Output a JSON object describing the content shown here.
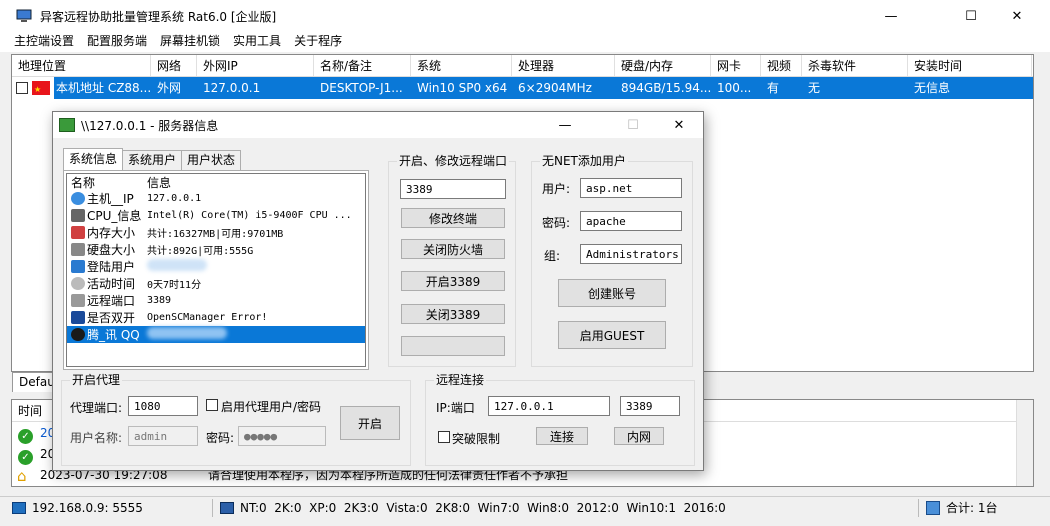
{
  "window": {
    "title": "异客远程协助批量管理系统 Rat6.0 [企业版]",
    "min": "—",
    "max": "☐",
    "close": "✕"
  },
  "menu": [
    "主控端设置",
    "配置服务端",
    "屏幕挂机锁",
    "实用工具",
    "关于程序"
  ],
  "grid": {
    "headers": [
      "地理位置",
      "网络",
      "外网IP",
      "名称/备注",
      "系统",
      "处理器",
      "硬盘/内存",
      "网卡",
      "视频",
      "杀毒软件",
      "安装时间"
    ],
    "row": [
      "本机地址 CZ88...",
      "外网",
      "127.0.0.1",
      "DESKTOP-J1...",
      "Win10 SP0 x64",
      "6×2904MHz",
      "894GB/15.94...",
      "100...",
      "有",
      "无",
      "无信息"
    ]
  },
  "bottom_tab": "Default",
  "log": {
    "header": "时间",
    "rows": [
      {
        "time": "20",
        "msg": ""
      },
      {
        "time": "20",
        "msg": ""
      },
      {
        "time": "2023-07-30 19:27:08",
        "msg": "请合理使用本程序，因为本程序所造成的任何法律责任作者不予承担"
      }
    ]
  },
  "status": {
    "ip": "192.168.0.9: 5555",
    "os": "NT:0  2K:0  XP:0  2K3:0  Vista:0  2K8:0  Win7:0  Win8:0  2012:0  Win10:1  2016:0",
    "total": "合计: 1台"
  },
  "dialog": {
    "title": "\\\\127.0.0.1 - 服务器信息",
    "tabs": [
      "系统信息",
      "系统用户",
      "用户状态"
    ],
    "info_head": [
      "名称",
      "信息"
    ],
    "info_rows": [
      {
        "k": "主机__IP",
        "v": "127.0.0.1",
        "icon": "globe-icon",
        "color": "#3a8ee0"
      },
      {
        "k": "CPU_信息",
        "v": "Intel(R) Core(TM) i5-9400F CPU ...",
        "icon": "cpu-icon",
        "color": "#666666"
      },
      {
        "k": "内存大小",
        "v": "共计:16327MB|可用:9701MB",
        "icon": "memory-icon",
        "color": "#d04040"
      },
      {
        "k": "硬盘大小",
        "v": "共计:892G|可用:555G",
        "icon": "disk-icon",
        "color": "#888888"
      },
      {
        "k": "登陆用户",
        "v": "",
        "icon": "user-icon",
        "color": "#2a7ad0"
      },
      {
        "k": "活动时间",
        "v": "0天7时11分",
        "icon": "clock-icon",
        "color": "#bbbbbb"
      },
      {
        "k": "远程端口",
        "v": "3389",
        "icon": "server-icon",
        "color": "#999999"
      },
      {
        "k": "是否双开",
        "v": "OpenSCManager Error!",
        "icon": "monitor-icon",
        "color": "#1a4a9a"
      },
      {
        "k": "腾_讯 QQ",
        "v": "",
        "icon": "qq-icon",
        "color": "#1a1a1a"
      }
    ],
    "port_group": {
      "label": "开启、修改远程端口",
      "value": "3389",
      "buttons": [
        "修改终端",
        "关闭防火墙",
        "开启3389",
        "关闭3389",
        ""
      ]
    },
    "user_group": {
      "label": "无NET添加用户",
      "user_label": "用户:",
      "user_value": "asp.net",
      "pass_label": "密码:",
      "pass_value": "apache",
      "group_label": "组:",
      "group_value": "Administrators",
      "create": "创建账号",
      "guest": "启用GUEST"
    },
    "proxy_group": {
      "label": "开启代理",
      "port_label": "代理端口:",
      "port_value": "1080",
      "auth_label": "启用代理用户/密码",
      "user_label": "用户名称:",
      "user_placeholder": "admin",
      "pass_label": "密码:",
      "pass_placeholder": "●●●●●",
      "start": "开启"
    },
    "remote_group": {
      "label": "远程连接",
      "ip_label": "IP:端口",
      "ip_value": "127.0.0.1",
      "port_value": "3389",
      "breakthrough": "突破限制",
      "connect": "连接",
      "intranet": "内网"
    }
  }
}
